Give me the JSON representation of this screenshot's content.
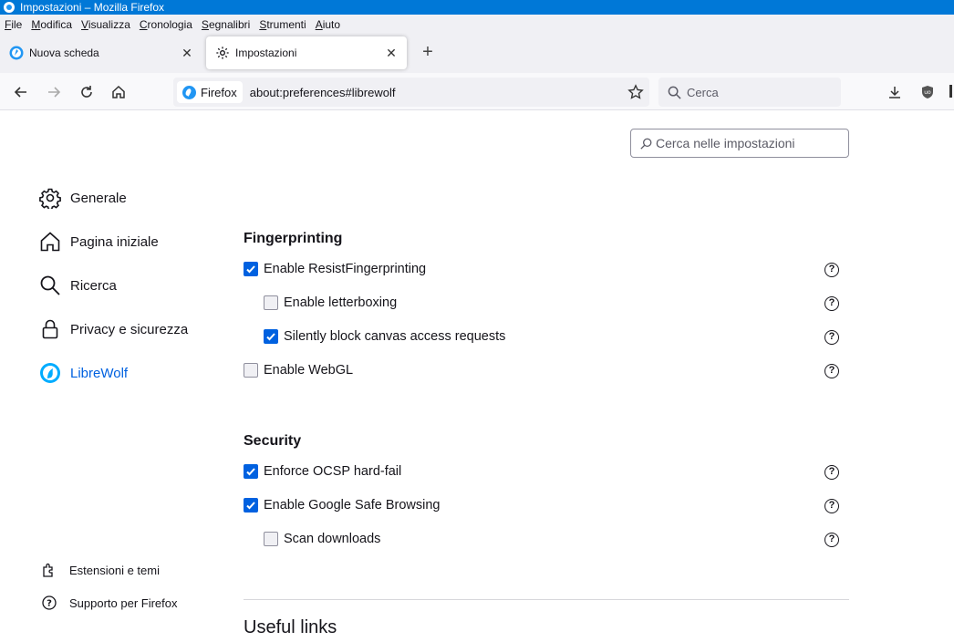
{
  "window": {
    "title": "Impostazioni – Mozilla Firefox"
  },
  "menubar": [
    "File",
    "Modifica",
    "Visualizza",
    "Cronologia",
    "Segnalibri",
    "Strumenti",
    "Aiuto"
  ],
  "tabs": [
    {
      "label": "Nuova scheda",
      "icon": "firefox-icon"
    },
    {
      "label": "Impostazioni",
      "icon": "gear-icon"
    }
  ],
  "navbar": {
    "identity_label": "Firefox",
    "url": "about:preferences#librewolf",
    "search_placeholder": "Cerca"
  },
  "settings_search": {
    "placeholder": "Cerca nelle impostazioni"
  },
  "categories": [
    {
      "label": "Generale",
      "icon": "gear-icon",
      "selected": false
    },
    {
      "label": "Pagina iniziale",
      "icon": "home-icon",
      "selected": false
    },
    {
      "label": "Ricerca",
      "icon": "search-icon",
      "selected": false
    },
    {
      "label": "Privacy e sicurezza",
      "icon": "lock-icon",
      "selected": false
    },
    {
      "label": "LibreWolf",
      "icon": "librewolf-icon",
      "selected": true
    }
  ],
  "footer_links": [
    {
      "label": "Estensioni e temi",
      "icon": "puzzle-icon"
    },
    {
      "label": "Supporto per Firefox",
      "icon": "help-circle-icon"
    }
  ],
  "sections": {
    "fingerprinting": {
      "title": "Fingerprinting",
      "options": [
        {
          "label": "Enable ResistFingerprinting",
          "checked": true
        },
        {
          "label": "Enable letterboxing",
          "checked": false
        },
        {
          "label": "Silently block canvas access requests",
          "checked": true
        },
        {
          "label": "Enable WebGL",
          "checked": false
        }
      ]
    },
    "security": {
      "title": "Security",
      "options": [
        {
          "label": "Enforce OCSP hard-fail",
          "checked": true
        },
        {
          "label": "Enable Google Safe Browsing",
          "checked": true
        },
        {
          "label": "Scan downloads",
          "checked": false
        }
      ]
    },
    "useful_links": {
      "title": "Useful links"
    }
  },
  "colors": {
    "accent": "#0061e0",
    "titlebar": "#0078d7"
  }
}
